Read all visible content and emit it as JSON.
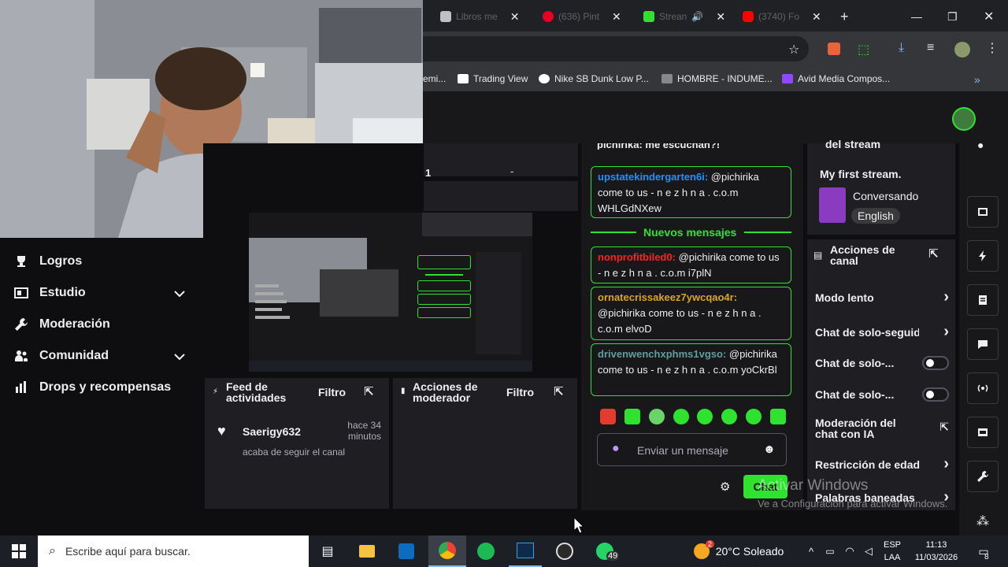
{
  "browser": {
    "tabs": [
      {
        "label": "Libros me",
        "color": "#bdc1c6"
      },
      {
        "label": "(636) Pint",
        "color": "#e60023"
      },
      {
        "label": "Strean",
        "color": "#9147ff",
        "active": true
      },
      {
        "label": "(3740) Fo",
        "color": "#ff0000"
      }
    ],
    "bookmarks": [
      "emi...",
      "Trading View",
      "Nike SB Dunk Low P...",
      "HOMBRE - INDUME...",
      "Avid Media Compos..."
    ]
  },
  "nav": {
    "items": [
      {
        "label": "Logros"
      },
      {
        "label": "Estudio"
      },
      {
        "label": "Moderación"
      },
      {
        "label": "Comunidad"
      },
      {
        "label": "Drops y recompensas"
      }
    ]
  },
  "feed": {
    "title": "Feed de actividades",
    "filter": "Filtro",
    "event": {
      "user": "Saerigy632",
      "time": "hace 34 minutos",
      "desc": "acaba de seguir el canal"
    }
  },
  "modactions": {
    "title": "Acciones de moderador",
    "filter": "Filtro"
  },
  "preview": {
    "number": "1",
    "dash": "-"
  },
  "chat": {
    "top_cut": "pichirika: me escuchan?!",
    "messages": [
      {
        "user": "upstatekindergarten6i",
        "color": "#1e90ff",
        "text": "@pichirika come to us - n e z h n a . c.o.m WHLGdNXew"
      },
      {
        "user": "nonprofitbiled0",
        "color": "#ff2020",
        "text": "@pichirika come to us - n e z h n a . c.o.m i7plN"
      },
      {
        "user": "ornatecrissakeez7ywcqao4r",
        "color": "#daa520",
        "text": "@pichirika come to us - n e z h n a . c.o.m elvoD"
      },
      {
        "user": "drivenwenchxphms1vgso",
        "color": "#5f9ea0",
        "text": "@pichirika come to us - n e z h n a . c.o.m yoCkrBl"
      }
    ],
    "new_messages": "Nuevos mensajes",
    "input_placeholder": "Enviar un mensaje",
    "send_label": "Chat"
  },
  "stream_info": {
    "heading": "del stream",
    "title": "My first stream.",
    "category": "Conversando",
    "tag": "English"
  },
  "channel_actions": {
    "title": "Acciones de canal",
    "rows": [
      {
        "label": "Modo lento",
        "kind": "arrow"
      },
      {
        "label": "Chat de solo-seguido",
        "kind": "arrow"
      },
      {
        "label": "Chat de solo-...",
        "kind": "toggle"
      },
      {
        "label": "Chat de solo-...",
        "kind": "toggle"
      },
      {
        "label": "Moderación del chat con IA",
        "kind": "external"
      },
      {
        "label": "Restricción de edad",
        "kind": "arrow"
      },
      {
        "label": "Palabras baneadas",
        "kind": "arrow"
      }
    ]
  },
  "watermark": {
    "line1": "Activar Windows",
    "line2": "Ve a Configuración para activar Windows."
  },
  "taskbar": {
    "search_placeholder": "Escribe aquí para buscar.",
    "weather": "20°C Soleado",
    "weather_badge": "2",
    "lang1": "ESP",
    "lang2": "LAA",
    "time": "11:13",
    "date": "11/03/2026",
    "whatsapp_badge": "49",
    "notif_count": "8"
  }
}
